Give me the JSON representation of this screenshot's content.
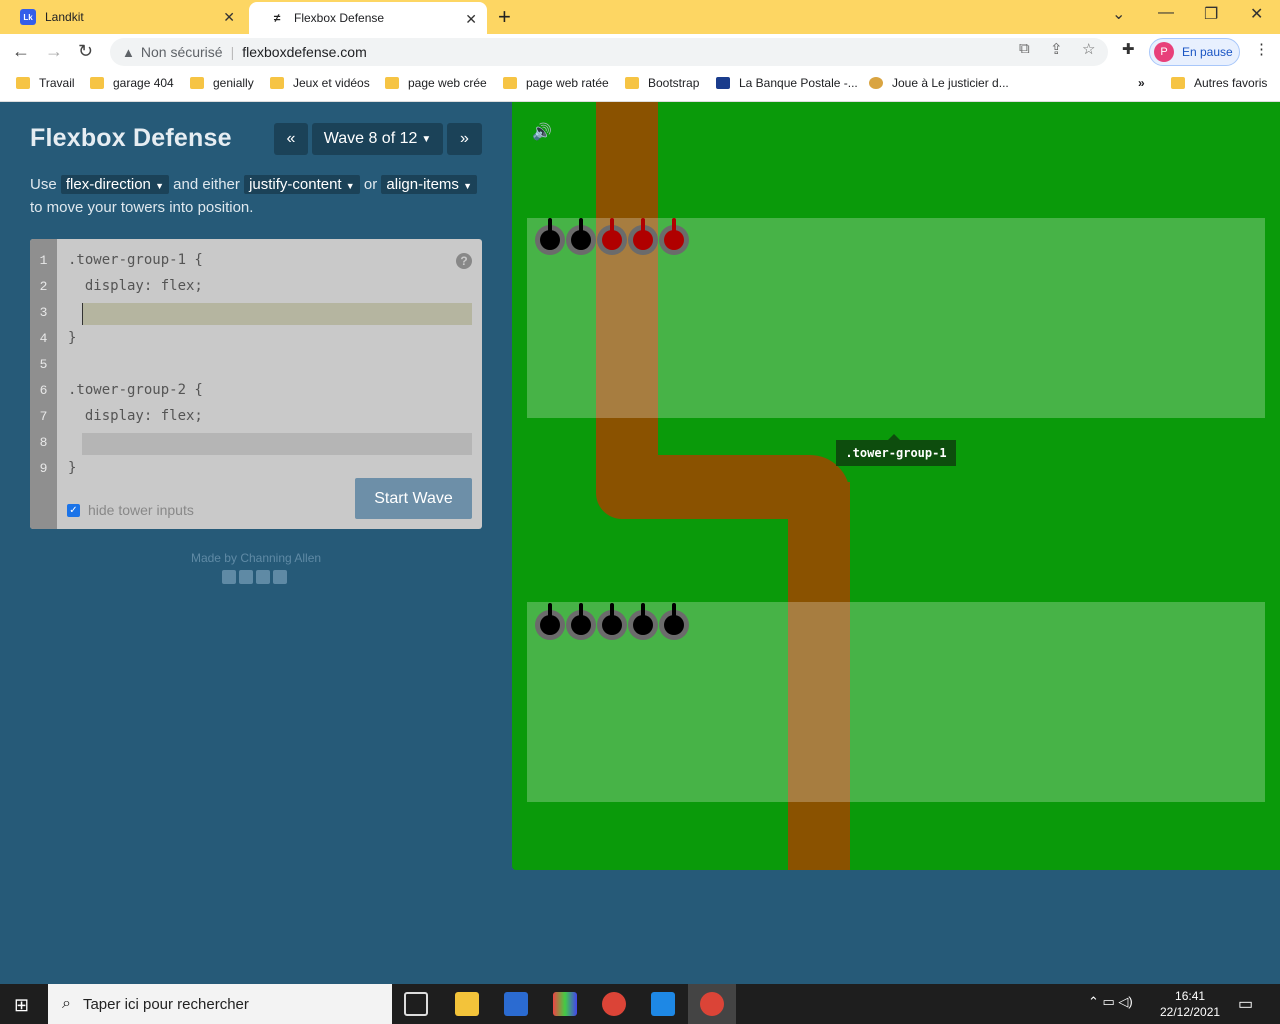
{
  "browser": {
    "tabs": [
      {
        "title": "Landkit",
        "favicon": "Lk"
      },
      {
        "title": "Flexbox Defense",
        "favicon": "≠"
      }
    ],
    "address": {
      "security": "Non sécurisé",
      "url": "flexboxdefense.com"
    },
    "profile": {
      "initial": "P",
      "label": "En pause"
    },
    "bookmarks": [
      "Travail",
      "garage 404",
      "genially",
      "Jeux et vidéos",
      "page web crée",
      "page web ratée",
      "Bootstrap",
      "La Banque Postale -...",
      "Joue à Le justicier d...",
      "Autres favoris"
    ]
  },
  "game": {
    "title": "Flexbox Defense",
    "wave_label": "Wave 8 of 12",
    "prev_icon": "«",
    "next_icon": "»",
    "instructions": {
      "use": "Use",
      "prop1": "flex-direction",
      "and_either": "and either",
      "prop2": "justify-content",
      "or": "or",
      "prop3": "align-items",
      "tail": "to move your towers into position."
    },
    "code": [
      ".tower-group-1 {",
      "  display: flex;",
      "",
      "}",
      "",
      ".tower-group-2 {",
      "  display: flex;",
      "",
      "}"
    ],
    "line_numbers": [
      "1",
      "2",
      "3",
      "4",
      "5",
      "6",
      "7",
      "8",
      "9"
    ],
    "hide_inputs_label": "hide tower inputs",
    "hide_inputs_checked": true,
    "start_button": "Start Wave",
    "credit": "Made by Channing Allen",
    "tooltip": ".tower-group-1",
    "tower_group_1": [
      "black",
      "black",
      "red",
      "red",
      "red"
    ],
    "tower_group_2": [
      "black",
      "black",
      "black",
      "black",
      "black"
    ],
    "colors": {
      "board": "#0a9a0a",
      "road": "#8a5200",
      "sidebar": "#265a78"
    }
  },
  "taskbar": {
    "search_placeholder": "Taper ici pour rechercher",
    "time": "16:41",
    "date": "22/12/2021"
  }
}
